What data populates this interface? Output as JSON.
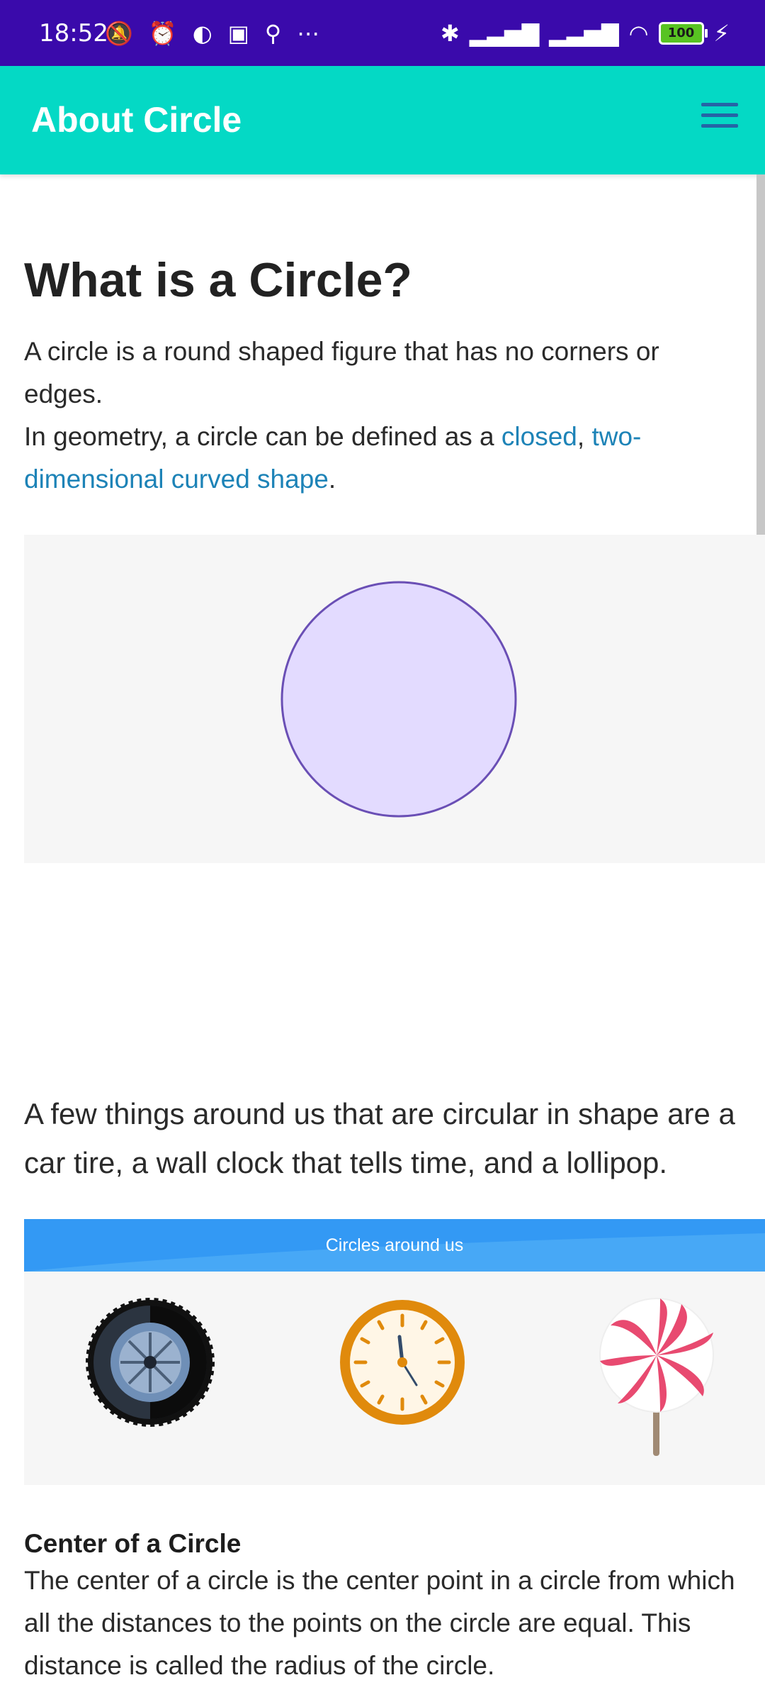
{
  "status_bar": {
    "time": "18:52",
    "battery": "100"
  },
  "app_bar": {
    "title": "About Circle"
  },
  "article": {
    "heading": "What is a Circle?",
    "intro_line1": "A circle is a round shaped figure that has no corners or edges.",
    "intro_line2_prefix": "In geometry, a circle can be defined as a ",
    "link_closed": "closed",
    "comma": ", ",
    "link_two_dimensional": "two-dimensional curved shape",
    "period": ".",
    "things_text": "A few things around us that are circular in shape are a car tire, a wall clock that tells time, and a lollipop.",
    "banner_title": "Circles around us",
    "center_title": "Center of a Circle",
    "center_body": "The center of a circle is the center point in a circle from which all the distances to the points on the circle are equal. This distance is called the radius of the circle."
  },
  "colors": {
    "status_bar": "#3a0aab",
    "app_bar": "#04d9c5",
    "link": "#1d83b7",
    "circle_fill": "#e3dbff",
    "circle_stroke": "#6a4fb5",
    "banner": "#3399f4"
  },
  "icons": [
    "mute-icon",
    "alarm-icon",
    "app-icon",
    "sim-icon",
    "bike-icon",
    "more-icon",
    "bluetooth-icon",
    "signal-icon",
    "wifi-icon",
    "battery-icon",
    "charging-icon",
    "menu-icon"
  ]
}
